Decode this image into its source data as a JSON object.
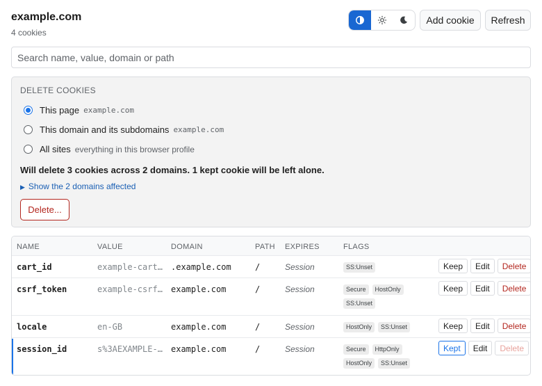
{
  "header": {
    "title": "example.com",
    "count_label": "4 cookies",
    "add_label": "Add cookie",
    "refresh_label": "Refresh",
    "theme_modes": [
      "contrast",
      "light",
      "dark"
    ],
    "theme_active": "contrast"
  },
  "search": {
    "placeholder": "Search name, value, domain or path",
    "value": ""
  },
  "delete_panel": {
    "heading": "DELETE COOKIES",
    "options": [
      {
        "label": "This page",
        "detail": "example.com",
        "checked": true
      },
      {
        "label": "This domain and its subdomains",
        "detail": "example.com",
        "checked": false
      },
      {
        "label": "All sites",
        "detail": "everything in this browser profile",
        "checked": false
      }
    ],
    "summary": "Will delete 3 cookies across 2 domains. 1 kept cookie will be left alone.",
    "details_label": "Show the 2 domains affected",
    "delete_button": "Delete..."
  },
  "table": {
    "headers": [
      "NAME",
      "VALUE",
      "DOMAIN",
      "PATH",
      "EXPIRES",
      "FLAGS"
    ],
    "rows": [
      {
        "name": "cart_id",
        "value": "example-cart…",
        "domain": ".example.com",
        "path": "/",
        "expires": "Session",
        "flags": [
          "SS:Unset"
        ],
        "keep": "Keep",
        "edit": "Edit",
        "delete": "Delete"
      },
      {
        "name": "csrf_token",
        "value": "example-csrf…",
        "domain": "example.com",
        "path": "/",
        "expires": "Session",
        "flags": [
          "Secure",
          "HostOnly",
          "SS:Unset"
        ],
        "keep": "Keep",
        "edit": "Edit",
        "delete": "Delete"
      },
      {
        "name": "locale",
        "value": "en-GB",
        "domain": "example.com",
        "path": "/",
        "expires": "Session",
        "flags": [
          "HostOnly",
          "SS:Unset"
        ],
        "keep": "Keep",
        "edit": "Edit",
        "delete": "Delete"
      },
      {
        "name": "session_id",
        "value": "s%3AEXAMPLE-…",
        "domain": "example.com",
        "path": "/",
        "expires": "Session",
        "flags": [
          "Secure",
          "HttpOnly",
          "HostOnly",
          "SS:Unset"
        ],
        "keep": "Kept",
        "edit": "Edit",
        "delete": "Delete"
      }
    ]
  },
  "colors": {
    "accent": "#1a73e8",
    "danger": "#b3261e",
    "panel_bg": "#f3f3f3"
  }
}
